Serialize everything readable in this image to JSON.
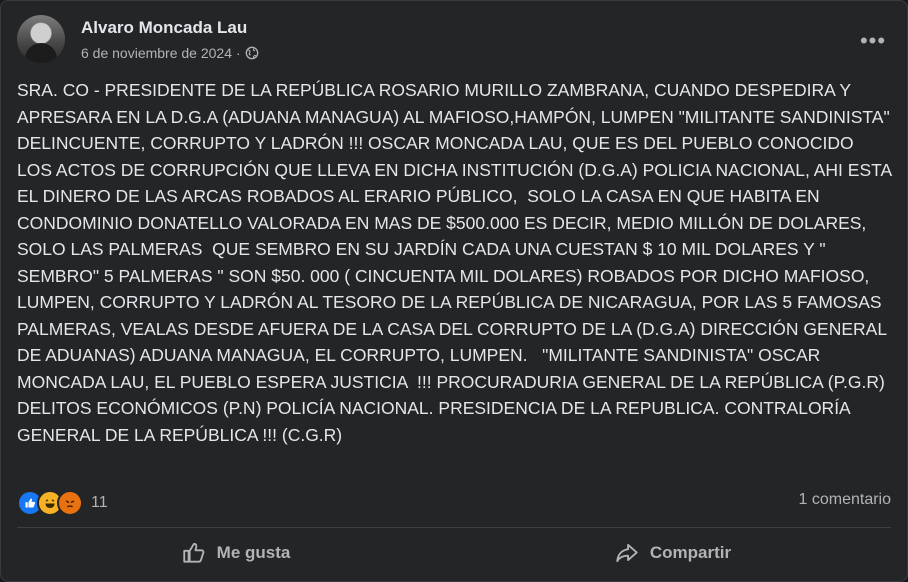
{
  "post": {
    "author": "Alvaro Moncada Lau",
    "date": "6 de noviembre de 2024",
    "separator": "·",
    "more_label": "•••",
    "text": "SRA. CO - PRESIDENTE DE LA REPÚBLICA ROSARIO MURILLO ZAMBRANA, CUANDO DESPEDIRA Y APRESARA EN LA D.G.A (ADUANA MANAGUA) AL MAFIOSO,HAMPÓN, LUMPEN \"MILITANTE SANDINISTA\"  DELINCUENTE, CORRUPTO Y LADRÓN !!! OSCAR MONCADA LAU, QUE ES DEL PUEBLO CONOCIDO LOS ACTOS DE CORRUPCIÓN QUE LLEVA EN DICHA INSTITUCIÓN (D.G.A) POLICIA NACIONAL, AHI ESTA EL DINERO DE LAS ARCAS ROBADOS AL ERARIO PÚBLICO,  SOLO LA CASA EN QUE HABITA EN CONDOMINIO DONATELLO VALORADA EN MAS DE $500.000 ES DECIR, MEDIO MILLÓN DE DOLARES,  SOLO LAS PALMERAS  QUE SEMBRO EN SU JARDÍN CADA UNA CUESTAN $ 10 MIL DOLARES Y \" SEMBRO\" 5 PALMERAS \" SON $50. 000 ( CINCUENTA MIL DOLARES) ROBADOS POR DICHO MAFIOSO, LUMPEN, CORRUPTO Y LADRÓN AL TESORO DE LA REPÚBLICA DE NICARAGUA, POR LAS 5 FAMOSAS PALMERAS, VEALAS DESDE AFUERA DE LA CASA DEL CORRUPTO DE LA (D.G.A) DIRECCIÓN GENERAL DE ADUANAS) ADUANA MANAGUA, EL CORRUPTO, LUMPEN.   \"MILITANTE SANDINISTA\" OSCAR MONCADA LAU, EL PUEBLO ESPERA JUSTICIA  !!! PROCURADURIA GENERAL DE LA REPÚBLICA (P.G.R) DELITOS ECONÓMICOS (P.N) POLICÍA NACIONAL. PRESIDENCIA DE LA REPUBLICA. CONTRALORÍA GENERAL DE LA REPÚBLICA !!! (C.G.R)"
  },
  "reactions": {
    "types": [
      "like-icon",
      "haha-icon",
      "angry-icon"
    ],
    "count": "11"
  },
  "comments_count": "1 comentario",
  "actions": {
    "like_label": "Me gusta",
    "share_label": "Compartir"
  },
  "colors": {
    "background": "#242526",
    "text": "#e4e6eb",
    "secondary": "#b0b3b8",
    "like_blue": "#1877f2"
  }
}
